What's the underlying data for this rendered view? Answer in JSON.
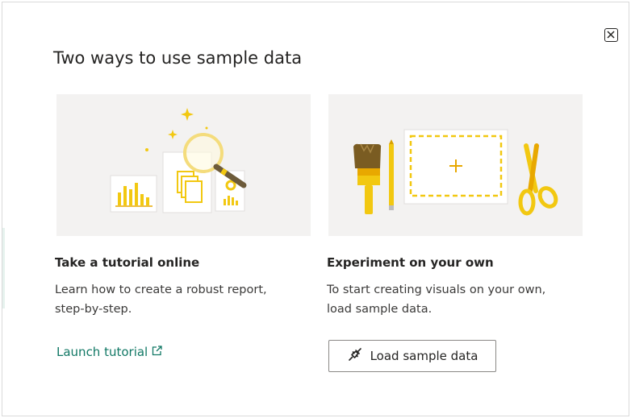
{
  "dialog": {
    "title": "Two ways to use sample data",
    "close_icon": "close-icon"
  },
  "tutorial": {
    "heading": "Take a tutorial online",
    "description": "Learn how to create a robust report, step-by-step.",
    "link_label": "Launch tutorial",
    "link_icon": "external-link-icon",
    "illustration": "report-magnifier-illustration"
  },
  "experiment": {
    "heading": "Experiment on your own",
    "description": "To start creating visuals on your own, load sample data.",
    "button_label": "Load sample data",
    "button_icon": "plug-icon",
    "illustration": "canvas-tools-illustration"
  },
  "colors": {
    "accent_link": "#117865",
    "illustration_yellow": "#f2c811",
    "card_bg": "#f3f2f1"
  }
}
